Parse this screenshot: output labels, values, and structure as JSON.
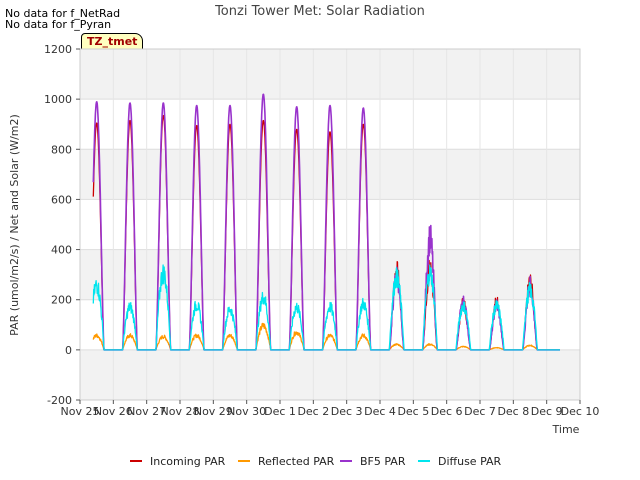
{
  "notes": [
    "No data for f_NetRad",
    "No data for f_Pyran"
  ],
  "site_tag": "TZ_tmet",
  "chart_data": {
    "type": "line",
    "title": "Tonzi Tower Met: Solar Radiation",
    "xlabel": "Time",
    "ylabel": "PAR (umol/m2/s) / Net and Solar (W/m2)",
    "ylim": [
      -200,
      1200
    ],
    "yticks": [
      -200,
      0,
      200,
      400,
      600,
      800,
      1000,
      1200
    ],
    "xlim": [
      0,
      15
    ],
    "xtick_labels": [
      "Nov 25",
      "Nov 26",
      "Nov 27",
      "Nov 28",
      "Nov 29",
      "Nov 30",
      "Dec 1",
      "Dec 2",
      "Dec 3",
      "Dec 4",
      "Dec 5",
      "Dec 6",
      "Dec 7",
      "Dec 8",
      "Dec 9",
      "Dec 10"
    ],
    "data_start_day": 0.4,
    "data_end_day": 14.4,
    "series": [
      {
        "name": "Incoming PAR",
        "color": "#cc0000",
        "daily_peak": [
          905,
          915,
          935,
          895,
          900,
          915,
          880,
          870,
          900,
          360,
          370,
          215,
          220,
          310
        ]
      },
      {
        "name": "Reflected PAR",
        "color": "#ff9900",
        "daily_peak": [
          65,
          65,
          60,
          65,
          65,
          110,
          80,
          65,
          65,
          25,
          25,
          15,
          10,
          20
        ]
      },
      {
        "name": "BF5 PAR",
        "color": "#9933cc",
        "daily_peak": [
          990,
          985,
          985,
          975,
          975,
          1020,
          970,
          975,
          965,
          340,
          510,
          220,
          205,
          295
        ]
      },
      {
        "name": "Diffuse PAR",
        "color": "#00e5ee",
        "daily_peak": [
          295,
          195,
          350,
          205,
          185,
          240,
          195,
          195,
          210,
          330,
          350,
          200,
          200,
          270
        ]
      }
    ],
    "grid": true,
    "legend_position": "bottom"
  }
}
